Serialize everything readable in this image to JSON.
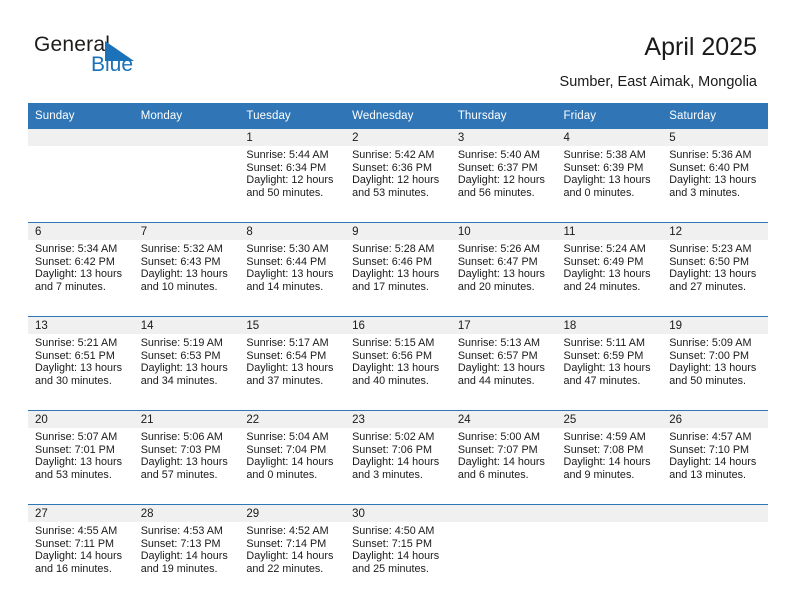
{
  "brand": {
    "name_top": "General",
    "name_bottom": "Blue",
    "accent_color": "#1B72B8"
  },
  "header": {
    "title": "April 2025",
    "subtitle": "Sumber, East Aimak, Mongolia"
  },
  "calendar": {
    "header_color": "#3076B6",
    "band_color": "#F0F0F0",
    "weekdays": [
      "Sunday",
      "Monday",
      "Tuesday",
      "Wednesday",
      "Thursday",
      "Friday",
      "Saturday"
    ],
    "weeks": [
      [
        {
          "day": "",
          "sunrise": "",
          "sunset": "",
          "daylight": ""
        },
        {
          "day": "",
          "sunrise": "",
          "sunset": "",
          "daylight": ""
        },
        {
          "day": "1",
          "sunrise": "Sunrise: 5:44 AM",
          "sunset": "Sunset: 6:34 PM",
          "daylight": "Daylight: 12 hours and 50 minutes."
        },
        {
          "day": "2",
          "sunrise": "Sunrise: 5:42 AM",
          "sunset": "Sunset: 6:36 PM",
          "daylight": "Daylight: 12 hours and 53 minutes."
        },
        {
          "day": "3",
          "sunrise": "Sunrise: 5:40 AM",
          "sunset": "Sunset: 6:37 PM",
          "daylight": "Daylight: 12 hours and 56 minutes."
        },
        {
          "day": "4",
          "sunrise": "Sunrise: 5:38 AM",
          "sunset": "Sunset: 6:39 PM",
          "daylight": "Daylight: 13 hours and 0 minutes."
        },
        {
          "day": "5",
          "sunrise": "Sunrise: 5:36 AM",
          "sunset": "Sunset: 6:40 PM",
          "daylight": "Daylight: 13 hours and 3 minutes."
        }
      ],
      [
        {
          "day": "6",
          "sunrise": "Sunrise: 5:34 AM",
          "sunset": "Sunset: 6:42 PM",
          "daylight": "Daylight: 13 hours and 7 minutes."
        },
        {
          "day": "7",
          "sunrise": "Sunrise: 5:32 AM",
          "sunset": "Sunset: 6:43 PM",
          "daylight": "Daylight: 13 hours and 10 minutes."
        },
        {
          "day": "8",
          "sunrise": "Sunrise: 5:30 AM",
          "sunset": "Sunset: 6:44 PM",
          "daylight": "Daylight: 13 hours and 14 minutes."
        },
        {
          "day": "9",
          "sunrise": "Sunrise: 5:28 AM",
          "sunset": "Sunset: 6:46 PM",
          "daylight": "Daylight: 13 hours and 17 minutes."
        },
        {
          "day": "10",
          "sunrise": "Sunrise: 5:26 AM",
          "sunset": "Sunset: 6:47 PM",
          "daylight": "Daylight: 13 hours and 20 minutes."
        },
        {
          "day": "11",
          "sunrise": "Sunrise: 5:24 AM",
          "sunset": "Sunset: 6:49 PM",
          "daylight": "Daylight: 13 hours and 24 minutes."
        },
        {
          "day": "12",
          "sunrise": "Sunrise: 5:23 AM",
          "sunset": "Sunset: 6:50 PM",
          "daylight": "Daylight: 13 hours and 27 minutes."
        }
      ],
      [
        {
          "day": "13",
          "sunrise": "Sunrise: 5:21 AM",
          "sunset": "Sunset: 6:51 PM",
          "daylight": "Daylight: 13 hours and 30 minutes."
        },
        {
          "day": "14",
          "sunrise": "Sunrise: 5:19 AM",
          "sunset": "Sunset: 6:53 PM",
          "daylight": "Daylight: 13 hours and 34 minutes."
        },
        {
          "day": "15",
          "sunrise": "Sunrise: 5:17 AM",
          "sunset": "Sunset: 6:54 PM",
          "daylight": "Daylight: 13 hours and 37 minutes."
        },
        {
          "day": "16",
          "sunrise": "Sunrise: 5:15 AM",
          "sunset": "Sunset: 6:56 PM",
          "daylight": "Daylight: 13 hours and 40 minutes."
        },
        {
          "day": "17",
          "sunrise": "Sunrise: 5:13 AM",
          "sunset": "Sunset: 6:57 PM",
          "daylight": "Daylight: 13 hours and 44 minutes."
        },
        {
          "day": "18",
          "sunrise": "Sunrise: 5:11 AM",
          "sunset": "Sunset: 6:59 PM",
          "daylight": "Daylight: 13 hours and 47 minutes."
        },
        {
          "day": "19",
          "sunrise": "Sunrise: 5:09 AM",
          "sunset": "Sunset: 7:00 PM",
          "daylight": "Daylight: 13 hours and 50 minutes."
        }
      ],
      [
        {
          "day": "20",
          "sunrise": "Sunrise: 5:07 AM",
          "sunset": "Sunset: 7:01 PM",
          "daylight": "Daylight: 13 hours and 53 minutes."
        },
        {
          "day": "21",
          "sunrise": "Sunrise: 5:06 AM",
          "sunset": "Sunset: 7:03 PM",
          "daylight": "Daylight: 13 hours and 57 minutes."
        },
        {
          "day": "22",
          "sunrise": "Sunrise: 5:04 AM",
          "sunset": "Sunset: 7:04 PM",
          "daylight": "Daylight: 14 hours and 0 minutes."
        },
        {
          "day": "23",
          "sunrise": "Sunrise: 5:02 AM",
          "sunset": "Sunset: 7:06 PM",
          "daylight": "Daylight: 14 hours and 3 minutes."
        },
        {
          "day": "24",
          "sunrise": "Sunrise: 5:00 AM",
          "sunset": "Sunset: 7:07 PM",
          "daylight": "Daylight: 14 hours and 6 minutes."
        },
        {
          "day": "25",
          "sunrise": "Sunrise: 4:59 AM",
          "sunset": "Sunset: 7:08 PM",
          "daylight": "Daylight: 14 hours and 9 minutes."
        },
        {
          "day": "26",
          "sunrise": "Sunrise: 4:57 AM",
          "sunset": "Sunset: 7:10 PM",
          "daylight": "Daylight: 14 hours and 13 minutes."
        }
      ],
      [
        {
          "day": "27",
          "sunrise": "Sunrise: 4:55 AM",
          "sunset": "Sunset: 7:11 PM",
          "daylight": "Daylight: 14 hours and 16 minutes."
        },
        {
          "day": "28",
          "sunrise": "Sunrise: 4:53 AM",
          "sunset": "Sunset: 7:13 PM",
          "daylight": "Daylight: 14 hours and 19 minutes."
        },
        {
          "day": "29",
          "sunrise": "Sunrise: 4:52 AM",
          "sunset": "Sunset: 7:14 PM",
          "daylight": "Daylight: 14 hours and 22 minutes."
        },
        {
          "day": "30",
          "sunrise": "Sunrise: 4:50 AM",
          "sunset": "Sunset: 7:15 PM",
          "daylight": "Daylight: 14 hours and 25 minutes."
        },
        {
          "day": "",
          "sunrise": "",
          "sunset": "",
          "daylight": ""
        },
        {
          "day": "",
          "sunrise": "",
          "sunset": "",
          "daylight": ""
        },
        {
          "day": "",
          "sunrise": "",
          "sunset": "",
          "daylight": ""
        }
      ]
    ]
  }
}
